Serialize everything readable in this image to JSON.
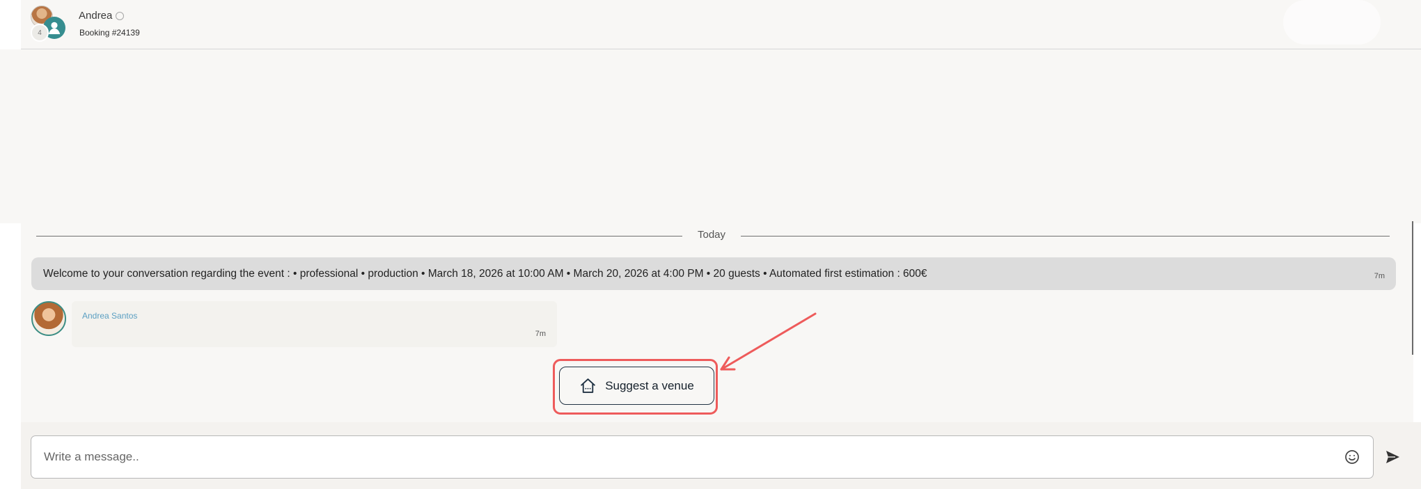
{
  "header": {
    "name": "Andrea",
    "booking": "Booking #24139",
    "guest_count": "4"
  },
  "conversation": {
    "date_divider": "Today",
    "system_message": "Welcome to your conversation regarding the event :  • professional  • production  • March 18, 2026 at 10:00 AM  • March 20, 2026 at 4:00 PM  • 20 guests  • Automated first estimation : 600€",
    "system_time": "7m",
    "message": {
      "sender": "Andrea Santos",
      "time": "7m"
    }
  },
  "actions": {
    "suggest_venue_label": "Suggest a venue"
  },
  "composer": {
    "placeholder": "Write a message.."
  },
  "icons": {
    "status": "status-circle-icon",
    "guest": "user-icon",
    "venue": "house-icon",
    "emoji": "smile-icon",
    "send": "send-icon",
    "annotation": "arrow-icon"
  },
  "colors": {
    "accent_teal": "#368d8f",
    "annotation_red": "#ee5b5b",
    "sender_blue": "#5b9fc2",
    "system_bubble": "#dcdcdc"
  }
}
